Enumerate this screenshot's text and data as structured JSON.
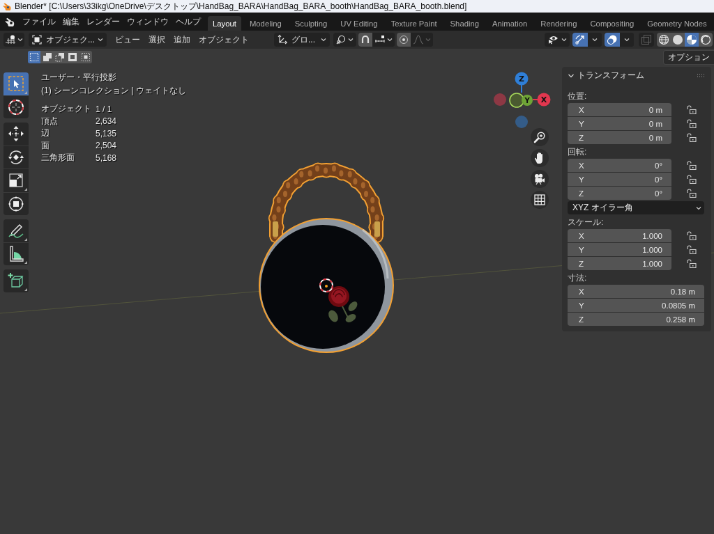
{
  "window": {
    "title": "Blender* [C:\\Users\\33ikg\\OneDrive\\デスクトップ\\HandBag_BARA\\HandBag_BARA_booth\\HandBag_BARA_booth.blend]"
  },
  "menu_bar": [
    "ファイル",
    "編集",
    "レンダー",
    "ウィンドウ",
    "ヘルプ"
  ],
  "workspace_tabs": [
    {
      "label": "Layout",
      "selected": true
    },
    {
      "label": "Modeling",
      "selected": false
    },
    {
      "label": "Sculpting",
      "selected": false
    },
    {
      "label": "UV Editing",
      "selected": false
    },
    {
      "label": "Texture Paint",
      "selected": false
    },
    {
      "label": "Shading",
      "selected": false
    },
    {
      "label": "Animation",
      "selected": false
    },
    {
      "label": "Rendering",
      "selected": false
    },
    {
      "label": "Compositing",
      "selected": false
    },
    {
      "label": "Geometry Nodes",
      "selected": false
    }
  ],
  "header": {
    "mode": "オブジェク...",
    "menus": [
      "ビュー",
      "選択",
      "追加",
      "オブジェクト"
    ],
    "orientation": "グロ...",
    "snap": {
      "on": false
    },
    "proportional": {
      "on": false
    },
    "gizmos": {
      "on": true
    },
    "overlays": {
      "on": true
    },
    "xray": {
      "on": false
    },
    "shading_modes": [
      {
        "kind": "wireframe",
        "selected": false
      },
      {
        "kind": "solid",
        "selected": false
      },
      {
        "kind": "material",
        "selected": true
      },
      {
        "kind": "rendered",
        "selected": false
      }
    ]
  },
  "selection_modes": [
    {
      "kind": "new",
      "selected": true
    },
    {
      "kind": "extend",
      "selected": false
    },
    {
      "kind": "subtract",
      "selected": false
    },
    {
      "kind": "invert",
      "selected": false
    },
    {
      "kind": "intersect",
      "selected": false
    }
  ],
  "options_button": "オプション",
  "toolbar": [
    [
      {
        "kind": "select",
        "selected": true,
        "flyout": true
      },
      {
        "kind": "cursor",
        "selected": false,
        "flyout": false
      }
    ],
    [
      {
        "kind": "move",
        "selected": false,
        "flyout": false
      },
      {
        "kind": "rotate",
        "selected": false,
        "flyout": false
      },
      {
        "kind": "scale",
        "selected": false,
        "flyout": true
      },
      {
        "kind": "transform",
        "selected": false,
        "flyout": false
      }
    ],
    [
      {
        "kind": "annotate",
        "selected": false,
        "flyout": true
      },
      {
        "kind": "measure",
        "selected": false,
        "flyout": true
      }
    ],
    [
      {
        "kind": "add",
        "selected": false,
        "flyout": true
      }
    ]
  ],
  "viewport_info": {
    "view": "ユーザー・平行投影",
    "collection": "(1) シーンコレクション | ウェイトなし",
    "stats": [
      {
        "label": "オブジェクト",
        "value": "1 / 1"
      },
      {
        "label": "頂点",
        "value": "2,634"
      },
      {
        "label": "辺",
        "value": "5,135"
      },
      {
        "label": "面",
        "value": "2,504"
      },
      {
        "label": "三角形面",
        "value": "5,168"
      }
    ]
  },
  "navigation_gizmo": {
    "axes": [
      {
        "label": "Z",
        "color": "#2f7fd8"
      },
      {
        "label": "Y",
        "color": "#6ea436"
      },
      {
        "label": "X",
        "color": "#e2374f"
      }
    ]
  },
  "transform_panel": {
    "title": "トランスフォーム",
    "expanded": true,
    "sections": [
      {
        "kind": "vector",
        "label": "位置:",
        "fields": [
          {
            "axis": "X",
            "value": "0 m",
            "locked": false
          },
          {
            "axis": "Y",
            "value": "0 m",
            "locked": false
          },
          {
            "axis": "Z",
            "value": "0 m",
            "locked": false
          }
        ]
      },
      {
        "kind": "vector",
        "label": "回転:",
        "fields": [
          {
            "axis": "X",
            "value": "0°",
            "locked": false
          },
          {
            "axis": "Y",
            "value": "0°",
            "locked": false
          },
          {
            "axis": "Z",
            "value": "0°",
            "locked": false
          }
        ]
      },
      {
        "kind": "dropdown",
        "value": "XYZ オイラー角"
      },
      {
        "kind": "vector",
        "label": "スケール:",
        "fields": [
          {
            "axis": "X",
            "value": "1.000",
            "locked": false
          },
          {
            "axis": "Y",
            "value": "1.000",
            "locked": false
          },
          {
            "axis": "Z",
            "value": "1.000",
            "locked": false
          }
        ]
      },
      {
        "kind": "vector",
        "label": "寸法:",
        "fields": [
          {
            "axis": "X",
            "value": "0.18 m"
          },
          {
            "axis": "Y",
            "value": "0.0805 m"
          },
          {
            "axis": "Z",
            "value": "0.258 m"
          }
        ]
      }
    ]
  }
}
